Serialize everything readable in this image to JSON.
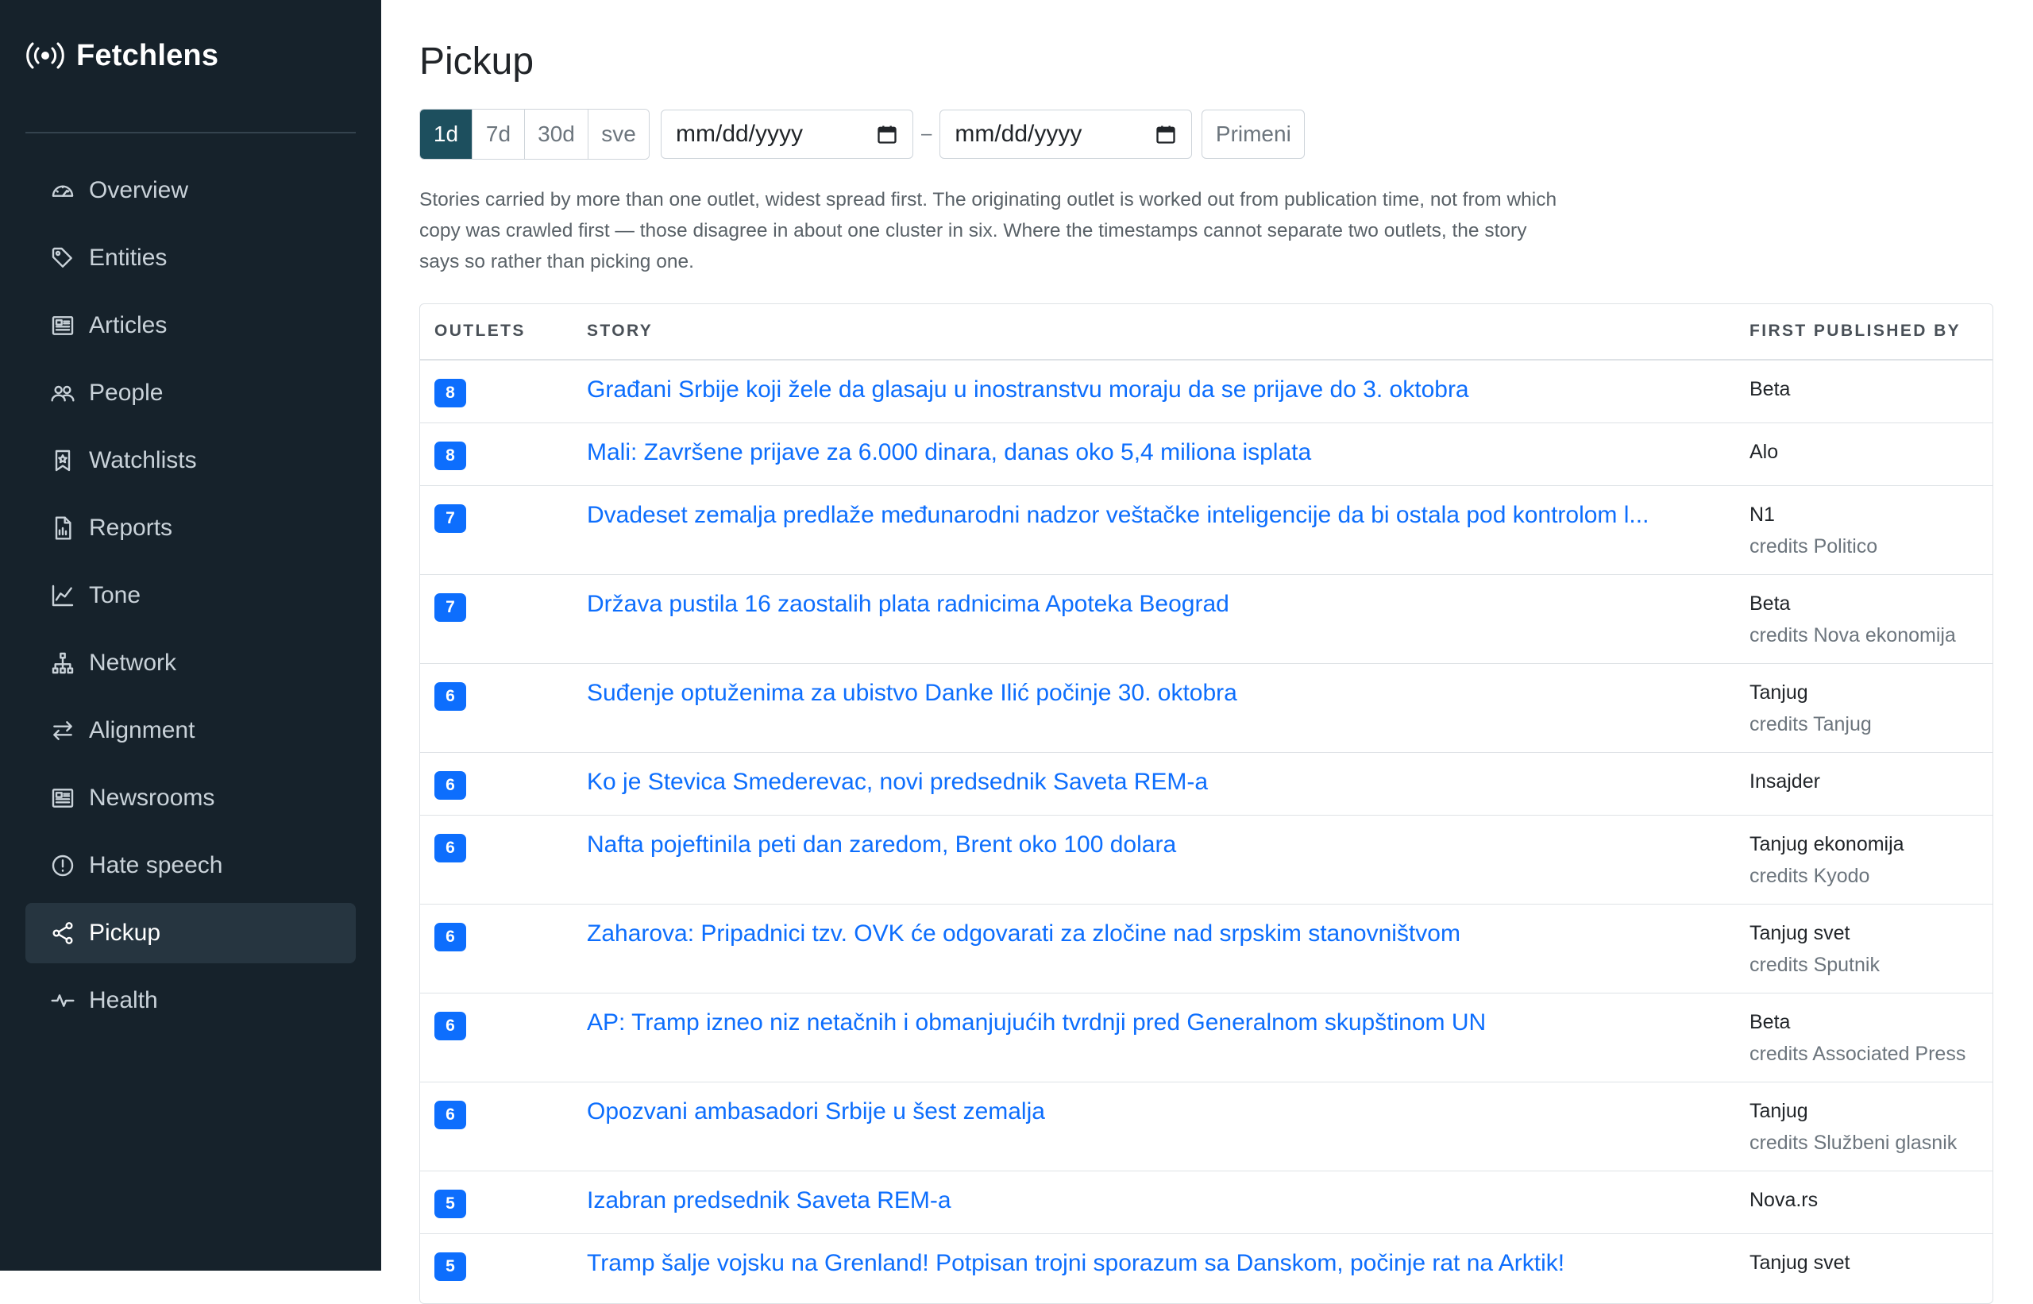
{
  "app": {
    "name": "Fetchlens",
    "logo_icon": "broadcast-icon"
  },
  "sidebar": {
    "items": [
      {
        "label": "Overview",
        "icon": "gauge-icon",
        "active": false
      },
      {
        "label": "Entities",
        "icon": "tag-icon",
        "active": false
      },
      {
        "label": "Articles",
        "icon": "newspaper-icon",
        "active": false
      },
      {
        "label": "People",
        "icon": "people-icon",
        "active": false
      },
      {
        "label": "Watchlists",
        "icon": "bookmark-star-icon",
        "active": false
      },
      {
        "label": "Reports",
        "icon": "file-chart-icon",
        "active": false
      },
      {
        "label": "Tone",
        "icon": "line-chart-icon",
        "active": false
      },
      {
        "label": "Network",
        "icon": "hierarchy-icon",
        "active": false
      },
      {
        "label": "Alignment",
        "icon": "arrows-left-right-icon",
        "active": false
      },
      {
        "label": "Newsrooms",
        "icon": "newspaper-icon",
        "active": false
      },
      {
        "label": "Hate speech",
        "icon": "exclamation-circle-icon",
        "active": false
      },
      {
        "label": "Pickup",
        "icon": "share-icon",
        "active": true
      },
      {
        "label": "Health",
        "icon": "activity-icon",
        "active": false
      }
    ]
  },
  "page": {
    "title": "Pickup",
    "ranges": [
      "1d",
      "7d",
      "30d",
      "sve"
    ],
    "active_range": "1d",
    "date_from": {
      "placeholder": "mm/dd/yyyy",
      "value": ""
    },
    "date_separator": "–",
    "date_to": {
      "placeholder": "mm/dd/yyyy",
      "value": ""
    },
    "apply_label": "Primeni",
    "description": "Stories carried by more than one outlet, widest spread first. The originating outlet is worked out from publication time, not from which copy was crawled first — those disagree in about one cluster in six. Where the timestamps cannot separate two outlets, the story says so rather than picking one."
  },
  "table": {
    "headers": {
      "outlets": "OUTLETS",
      "story": "STORY",
      "first_published_by": "FIRST PUBLISHED BY"
    },
    "rows": [
      {
        "outlets": "8",
        "story": "Građani Srbije koji žele da glasaju u inostranstvu moraju da se prijave do 3. oktobra",
        "source": "Beta",
        "credits": ""
      },
      {
        "outlets": "8",
        "story": "Mali: Završene prijave za 6.000 dinara, danas oko 5,4 miliona isplata",
        "source": "Alo",
        "credits": ""
      },
      {
        "outlets": "7",
        "story": "Dvadeset zemalja predlaže međunarodni nadzor veštačke inteligencije da bi ostala pod kontrolom l...",
        "source": "N1",
        "credits": "credits Politico"
      },
      {
        "outlets": "7",
        "story": "Država pustila 16 zaostalih plata radnicima Apoteka Beograd",
        "source": "Beta",
        "credits": "credits Nova ekonomija"
      },
      {
        "outlets": "6",
        "story": "Suđenje optuženima za ubistvo Danke Ilić počinje 30. oktobra",
        "source": "Tanjug",
        "credits": "credits Tanjug"
      },
      {
        "outlets": "6",
        "story": "Ko je Stevica Smederevac, novi predsednik Saveta REM-a",
        "source": "Insajder",
        "credits": ""
      },
      {
        "outlets": "6",
        "story": "Nafta pojeftinila peti dan zaredom, Brent oko 100 dolara",
        "source": "Tanjug ekonomija",
        "credits": "credits Kyodo"
      },
      {
        "outlets": "6",
        "story": "Zaharova: Pripadnici tzv. OVK će odgovarati za zločine nad srpskim stanovništvom",
        "source": "Tanjug svet",
        "credits": "credits Sputnik"
      },
      {
        "outlets": "6",
        "story": "AP: Tramp izneo niz netačnih i obmanjujućih tvrdnji pred Generalnom skupštinom UN",
        "source": "Beta",
        "credits": "credits Associated Press"
      },
      {
        "outlets": "6",
        "story": "Opozvani ambasadori Srbije u šest zemalja",
        "source": "Tanjug",
        "credits": "credits Službeni glasnik"
      },
      {
        "outlets": "5",
        "story": "Izabran predsednik Saveta REM-a",
        "source": "Nova.rs",
        "credits": ""
      },
      {
        "outlets": "5",
        "story": "Tramp šalje vojsku na Grenland! Potpisan trojni sporazum sa Danskom, počinje rat na Arktik!",
        "source": "Tanjug svet",
        "credits": ""
      }
    ]
  },
  "colors": {
    "sidebar_bg": "#16222b",
    "active_nav_bg": "#263540",
    "accent": "#1d4f5e",
    "link": "#0d6efd",
    "badge": "#0d6efd"
  }
}
